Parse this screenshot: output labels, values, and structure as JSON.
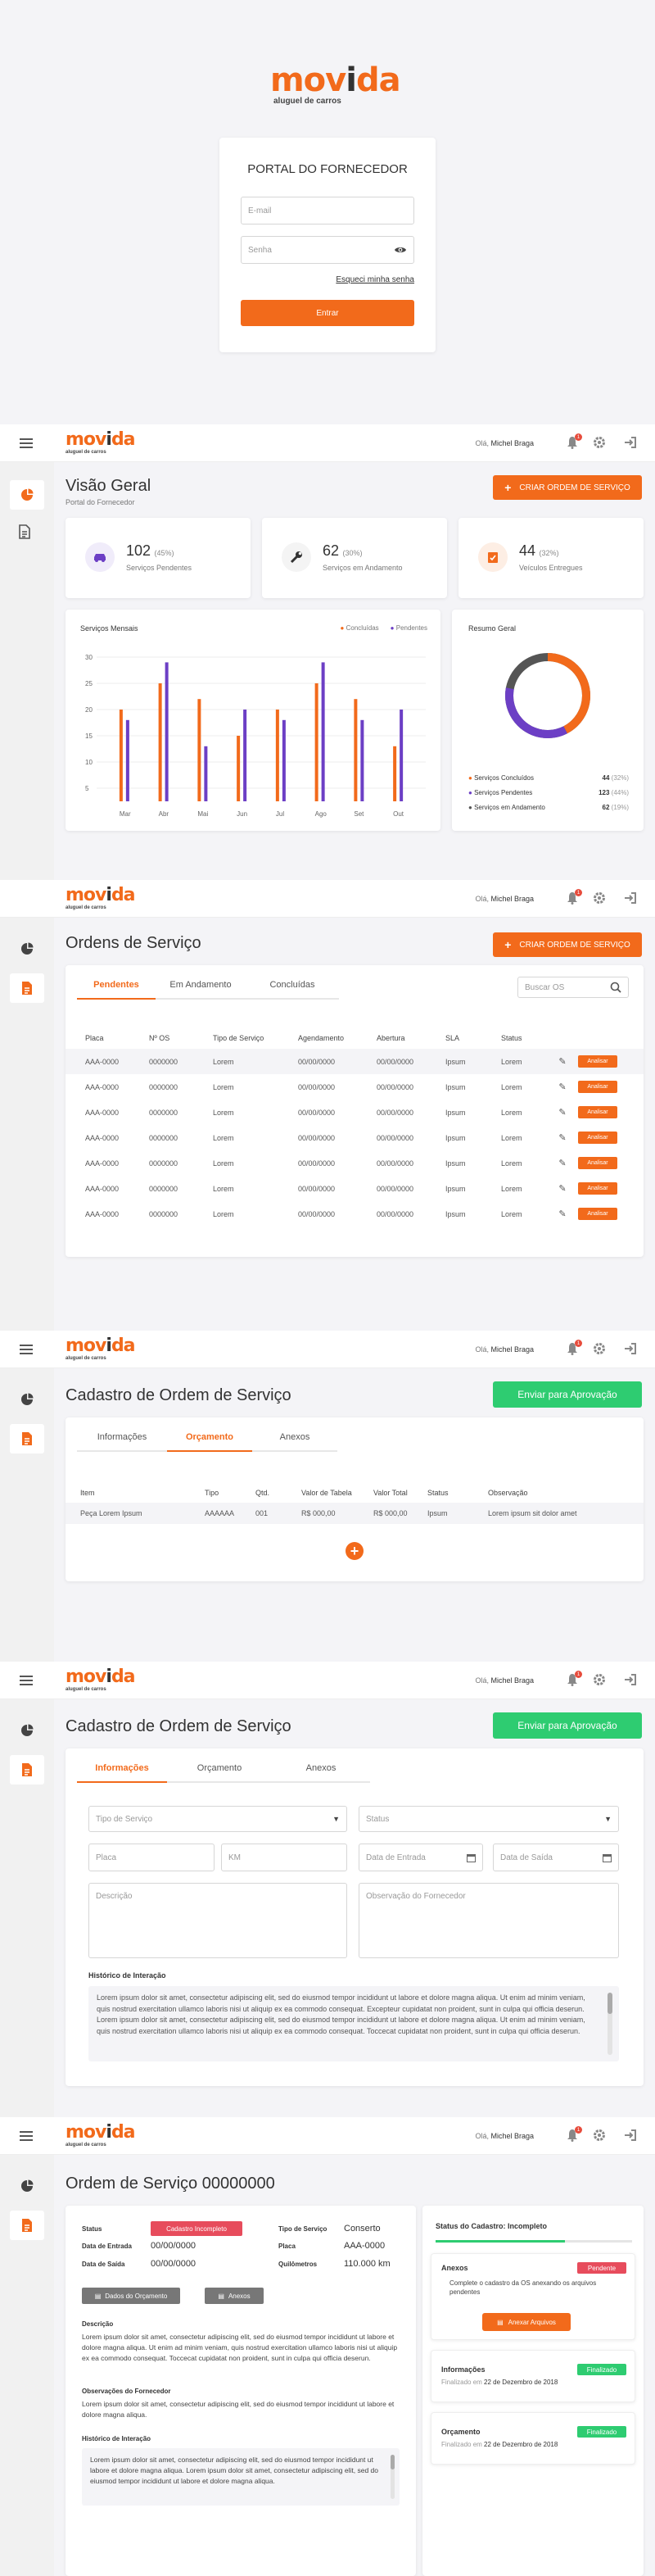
{
  "brand": {
    "name_orange": "mov",
    "name_dark": "i",
    "name_rest": "da",
    "tagline": "aluguel de carros",
    "accent": "#f26a1b"
  },
  "login": {
    "title": "PORTAL DO FORNECEDOR",
    "email_placeholder": "E-mail",
    "password_placeholder": "Senha",
    "forgot": "Esqueci minha senha",
    "submit": "Entrar"
  },
  "topbar": {
    "greeting": "Olá,",
    "user": "Michel Braga",
    "notifications": "1"
  },
  "dashboard": {
    "title": "Visão Geral",
    "subtitle": "Portal do Fornecedor",
    "create_button": "CRIAR ORDEM DE SERVIÇO",
    "stats": [
      {
        "value": "102",
        "pct": "(45%)",
        "label": "Serviços Pendentes"
      },
      {
        "value": "62",
        "pct": "(30%)",
        "label": "Serviços em Andamento"
      },
      {
        "value": "44",
        "pct": "(32%)",
        "label": "Veículos Entregues"
      }
    ],
    "chart_title": "Serviços Mensais",
    "legend_done": "Concluídas",
    "legend_pending": "Pendentes",
    "summary_title": "Resumo Geral",
    "summary": [
      {
        "label": "Serviços Concluídos",
        "value": "44",
        "pct": "(32%)",
        "color": "#f26a1b"
      },
      {
        "label": "Serviços Pendentes",
        "value": "123",
        "pct": "(44%)",
        "color": "#6c3fc5"
      },
      {
        "label": "Serviços em Andamento",
        "value": "62",
        "pct": "(19%)",
        "color": "#555555"
      }
    ]
  },
  "chart_data": {
    "type": "bar",
    "title": "Serviços Mensais",
    "categories": [
      "Mar",
      "Abr",
      "Mai",
      "Jun",
      "Jul",
      "Ago",
      "Set",
      "Out"
    ],
    "ylim": [
      0,
      30
    ],
    "yticks": [
      "30",
      "25",
      "20",
      "15",
      "10",
      "5"
    ],
    "series": [
      {
        "name": "Concluídas",
        "color": "#f26a1b",
        "values": [
          20,
          25,
          22,
          15,
          20,
          25,
          22,
          13
        ]
      },
      {
        "name": "Pendentes",
        "color": "#6c3fc5",
        "values": [
          18,
          29,
          13,
          20,
          18,
          29,
          18,
          20
        ]
      }
    ]
  },
  "orders": {
    "title": "Ordens de Serviço",
    "create_button": "CRIAR ORDEM DE SERVIÇO",
    "tabs": [
      "Pendentes",
      "Em Andamento",
      "Concluídas"
    ],
    "search_placeholder": "Buscar OS",
    "headers": [
      "Placa",
      "Nº OS",
      "Tipo de Serviço",
      "Agendamento",
      "Abertura",
      "SLA",
      "Status"
    ],
    "rows": [
      [
        "AAA-0000",
        "0000000",
        "Lorem",
        "00/00/0000",
        "00/00/0000",
        "Ipsum",
        "Lorem"
      ],
      [
        "AAA-0000",
        "0000000",
        "Lorem",
        "00/00/0000",
        "00/00/0000",
        "Ipsum",
        "Lorem"
      ],
      [
        "AAA-0000",
        "0000000",
        "Lorem",
        "00/00/0000",
        "00/00/0000",
        "Ipsum",
        "Lorem"
      ],
      [
        "AAA-0000",
        "0000000",
        "Lorem",
        "00/00/0000",
        "00/00/0000",
        "Ipsum",
        "Lorem"
      ],
      [
        "AAA-0000",
        "0000000",
        "Lorem",
        "00/00/0000",
        "00/00/0000",
        "Ipsum",
        "Lorem"
      ],
      [
        "AAA-0000",
        "0000000",
        "Lorem",
        "00/00/0000",
        "00/00/0000",
        "Ipsum",
        "Lorem"
      ],
      [
        "AAA-0000",
        "0000000",
        "Lorem",
        "00/00/0000",
        "00/00/0000",
        "Ipsum",
        "Lorem"
      ]
    ],
    "row_action": "Analisar"
  },
  "budget": {
    "title": "Cadastro de Ordem de Serviço",
    "send_button": "Enviar para Aprovação",
    "tabs": [
      "Informações",
      "Orçamento",
      "Anexos"
    ],
    "headers": [
      "Item",
      "Tipo",
      "Qtd.",
      "Valor de Tabela",
      "Valor Total",
      "Status",
      "Observação"
    ],
    "row": [
      "Peça Lorem Ipsum",
      "AAAAAA",
      "001",
      "R$ 000,00",
      "R$ 000,00",
      "Ipsum",
      "Lorem ipsum sit dolor amet"
    ]
  },
  "info": {
    "title": "Cadastro de Ordem de Serviço",
    "send_button": "Enviar para Aprovação",
    "tabs": [
      "Informações",
      "Orçamento",
      "Anexos"
    ],
    "service_type": "Tipo de Serviço",
    "status": "Status",
    "plate": "Placa",
    "km": "KM",
    "entry_date": "Data de Entrada",
    "exit_date": "Data de Saída",
    "description": "Descrição",
    "supplier_note": "Observação do Fornecedor",
    "history_title": "Histórico de Interação",
    "history_text": "Lorem ipsum dolor sit amet, consectetur adipiscing elit, sed do eiusmod tempor incididunt ut labore et dolore magna aliqua. Ut enim ad minim veniam, quis nostrud exercitation ullamco laboris nisi ut aliquip ex ea commodo consequat. Excepteur cupidatat non proident, sunt in culpa qui officia deserun. Lorem ipsum dolor sit amet, consectetur adipiscing elit, sed do eiusmod tempor incididunt ut labore et dolore magna aliqua. Ut enim ad minim veniam, quis nostrud exercitation ullamco laboris nisi ut aliquip ex ea commodo consequat. Toccecat cupidatat non proident, sunt in culpa qui officia deserun."
  },
  "detail": {
    "title": "Ordem de Serviço 00000000",
    "status_label": "Status",
    "status_value": "Cadastro Incompleto",
    "entry_label": "Data de Entrada",
    "entry_value": "00/00/0000",
    "exit_label": "Data de Saída",
    "exit_value": "00/00/0000",
    "type_label": "Tipo de Serviço",
    "type_value": "Conserto",
    "plate_label": "Placa",
    "plate_value": "AAA-0000",
    "km_label": "Quilômetros",
    "km_value": "110.000 km",
    "budget_btn": "Dados do Orçamento",
    "attach_btn": "Anexos",
    "desc_label": "Descrição",
    "desc_text": "Lorem ipsum dolor sit amet, consectetur adipiscing elit, sed do eiusmod tempor incididunt ut labore et dolore magna aliqua. Ut enim ad minim veniam, quis nostrud exercitation ullamco laboris nisi ut aliquip ex ea commodo consequat. Toccecat cupidatat non proident, sunt in culpa qui officia deserun.",
    "note_label": "Observações do Fornecedor",
    "note_text": "Lorem ipsum dolor sit amet, consectetur adipiscing elit, sed do eiusmod tempor incididunt ut labore et dolore magna aliqua.",
    "hist_label": "Histórico de Interação",
    "hist_text": "Lorem ipsum dolor sit amet, consectetur adipiscing elit, sed do eiusmod tempor incididunt ut labore et dolore magna aliqua. Lorem ipsum dolor sit amet, consectetur adipiscing elit, sed do eiusmod tempor incididunt ut labore et dolore magna aliqua.",
    "side_title": "Status do Cadastro: Incompleto",
    "attach_title": "Anexos",
    "attach_badge": "Pendente",
    "attach_item": "Complete o cadastro da OS anexando os arquivos pendentes",
    "attach_button": "Anexar Arquivos",
    "info_title": "Informações",
    "info_badge": "Finalizado",
    "info_date_label": "Finalizado em",
    "info_date": "22 de Dezembro de 2018",
    "budget_title": "Orçamento",
    "budget_badge": "Finalizado",
    "budget_date_label": "Finalizado em",
    "budget_date": "22 de Dezembro de 2018"
  }
}
